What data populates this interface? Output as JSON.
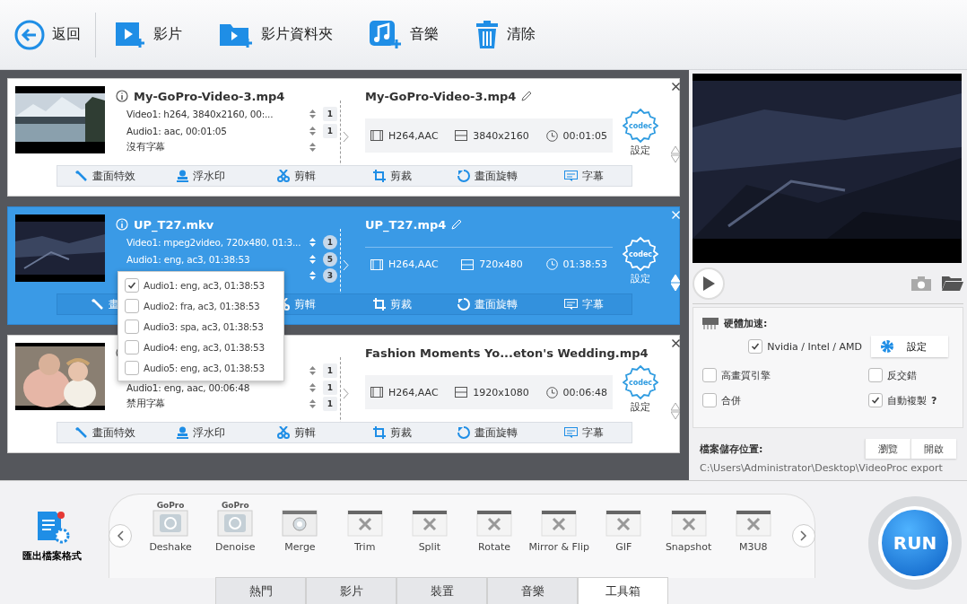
{
  "toolbar": [
    {
      "kind": "back",
      "label": "返回"
    },
    {
      "kind": "video",
      "label": "影片"
    },
    {
      "kind": "folder",
      "label": "影片資料夾"
    },
    {
      "kind": "music",
      "label": "音樂"
    },
    {
      "kind": "clear",
      "label": "清除"
    }
  ],
  "cards": [
    {
      "selected": false,
      "source_name": "My-GoPro-Video-3.mp4",
      "streams": [
        {
          "text": "Video1: h264, 3840x2160, 00:...",
          "count": "1"
        },
        {
          "text": "Audio1: aac, 00:01:05",
          "count": "1"
        },
        {
          "text": "沒有字幕"
        }
      ],
      "target_name": "My-GoPro-Video-3.mp4",
      "format": "H264,AAC",
      "resolution": "3840x2160",
      "duration": "00:01:05",
      "codec": "codec",
      "codec_label": "設定",
      "actions": [
        {
          "kind": "effect",
          "label": "畫面特效"
        },
        {
          "kind": "watermark",
          "label": "浮水印"
        },
        {
          "kind": "cut",
          "label": "剪輯"
        },
        {
          "kind": "crop",
          "label": "剪裁"
        },
        {
          "kind": "rotate",
          "label": "畫面旋轉"
        },
        {
          "kind": "subtitle",
          "label": "字幕"
        }
      ]
    },
    {
      "selected": true,
      "source_name": "UP_T27.mkv",
      "streams": [
        {
          "text": "Video1: mpeg2video, 720x480, 01:3...",
          "count": "1"
        },
        {
          "text": "Audio1: eng, ac3, 01:38:53",
          "count": "5"
        },
        {
          "count": "3"
        }
      ],
      "target_name": "UP_T27.mp4",
      "format": "H264,AAC",
      "resolution": "720x480",
      "duration": "01:38:53",
      "codec": "codec",
      "codec_label": "設定",
      "actions": [
        {
          "kind": "effect",
          "label": "畫"
        },
        {
          "kind": "covered"
        },
        {
          "kind": "cut",
          "label": "剪輯"
        },
        {
          "kind": "crop",
          "label": "剪裁"
        },
        {
          "kind": "rotate",
          "label": "畫面旋轉"
        },
        {
          "kind": "subtitle",
          "label": "字幕"
        }
      ]
    },
    {
      "selected": false,
      "streams": [
        {
          "count": "1"
        },
        {
          "text": "Audio1: eng, aac, 00:06:48",
          "count": "1"
        },
        {
          "text": "禁用字幕",
          "count": "1"
        }
      ],
      "target_name": "Fashion Moments Yo...eton's Wedding.mp4",
      "format": "H264,AAC",
      "resolution": "1920x1080",
      "duration": "00:06:48",
      "codec": "codec",
      "codec_label": "設定",
      "actions": [
        {
          "kind": "effect",
          "label": "畫面特效"
        },
        {
          "kind": "watermark",
          "label": "浮水印"
        },
        {
          "kind": "cut",
          "label": "剪輯"
        },
        {
          "kind": "crop",
          "label": "剪裁"
        },
        {
          "kind": "rotate",
          "label": "畫面旋轉"
        },
        {
          "kind": "subtitle",
          "label": "字幕"
        }
      ]
    }
  ],
  "audio_menu": [
    {
      "label": "Audio1: eng, ac3, 01:38:53",
      "checked": true
    },
    {
      "label": "Audio2: fra, ac3, 01:38:53",
      "checked": false
    },
    {
      "label": "Audio3: spa, ac3, 01:38:53",
      "checked": false
    },
    {
      "label": "Audio4: eng, ac3, 01:38:53",
      "checked": false
    },
    {
      "label": "Audio5: eng, ac3, 01:38:53",
      "checked": false
    }
  ],
  "hardware": {
    "title": "硬體加速:",
    "gpu": {
      "label": "Nvidia / Intel / AMD",
      "checked": true
    },
    "settings_button": "設定"
  },
  "options": [
    {
      "label": "高畫質引擎",
      "checked": false
    },
    {
      "label": "反交錯",
      "checked": false
    },
    {
      "label": "合併",
      "checked": false
    },
    {
      "label": "自動複製",
      "checked": true,
      "help": "?"
    }
  ],
  "output": {
    "title": "檔案儲存位置:",
    "buttons": [
      "瀏覽",
      "開啟"
    ],
    "path": "C:\\Users\\Administrator\\Desktop\\VideoProc export"
  },
  "export_label": "匯出檔案格式",
  "tools": [
    {
      "kind": "gopro",
      "badge": "GoPro",
      "label": "Deshake"
    },
    {
      "kind": "gopro",
      "badge": "GoPro",
      "label": "Denoise"
    },
    {
      "kind": "merge",
      "label": "Merge"
    },
    {
      "kind": "tool",
      "label": "Trim"
    },
    {
      "kind": "tool",
      "label": "Split"
    },
    {
      "kind": "tool",
      "label": "Rotate"
    },
    {
      "kind": "tool",
      "label": "Mirror & Flip"
    },
    {
      "kind": "tool",
      "label": "GIF"
    },
    {
      "kind": "tool",
      "label": "Snapshot"
    },
    {
      "kind": "tool",
      "label": "M3U8"
    }
  ],
  "run": "RUN",
  "tabs": [
    {
      "label": "熱門",
      "selected": false
    },
    {
      "label": "影片",
      "selected": false
    },
    {
      "label": "裝置",
      "selected": false
    },
    {
      "label": "音樂",
      "selected": false
    },
    {
      "label": "工具箱",
      "selected": true
    }
  ]
}
